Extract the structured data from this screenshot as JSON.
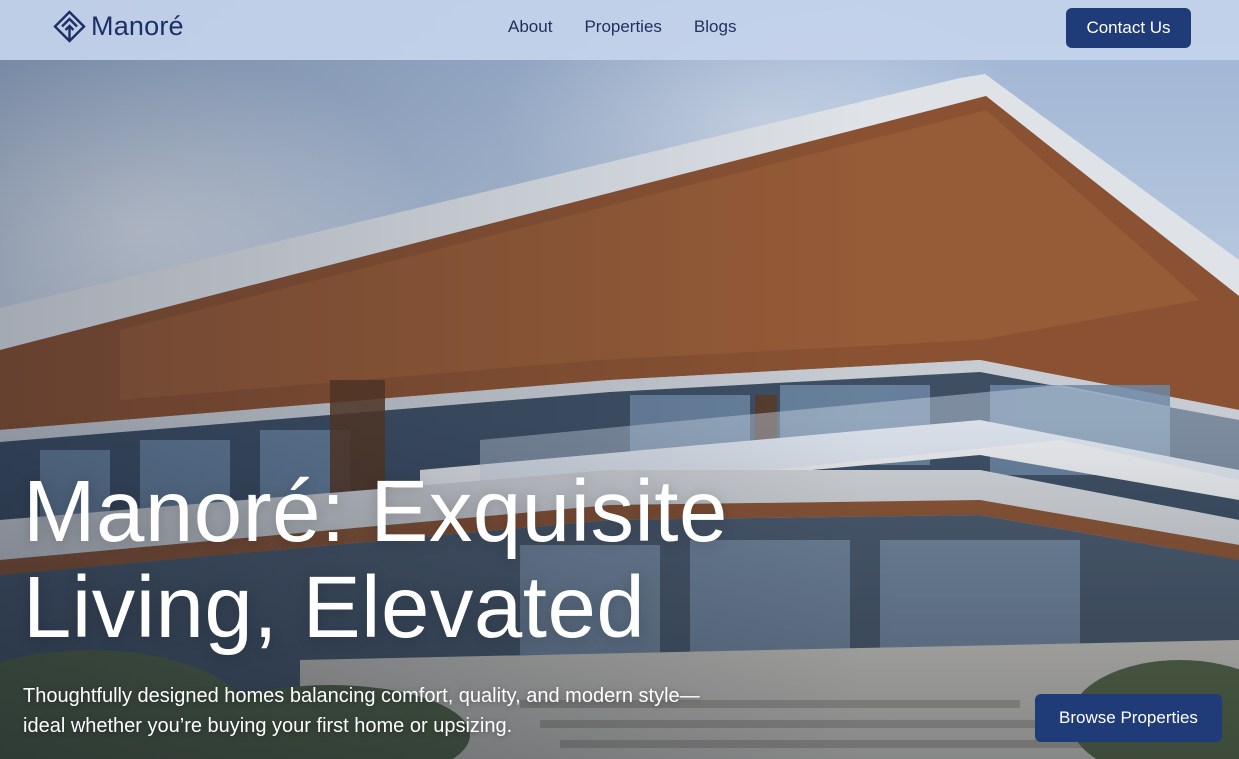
{
  "brand": {
    "name": "Manoré",
    "logo_icon": "diamond-logo-icon"
  },
  "nav": {
    "items": [
      {
        "label": "About"
      },
      {
        "label": "Properties"
      },
      {
        "label": "Blogs"
      }
    ]
  },
  "header": {
    "cta_label": "Contact Us"
  },
  "hero": {
    "title_line1": "Manoré: Exquisite",
    "title_line2": "Living, Elevated",
    "subtitle_line1": "Thoughtfully designed homes balancing comfort, quality, and modern style—",
    "subtitle_line2": "ideal whether you’re buying your first home or upsizing.",
    "cta_label": "Browse Properties",
    "image_alt": "modern-house-photo"
  },
  "colors": {
    "brand_navy": "#1f3b78",
    "header_bg": "#c4d4ec",
    "text_dark": "#1e2f5e",
    "hero_text": "#ffffff"
  }
}
